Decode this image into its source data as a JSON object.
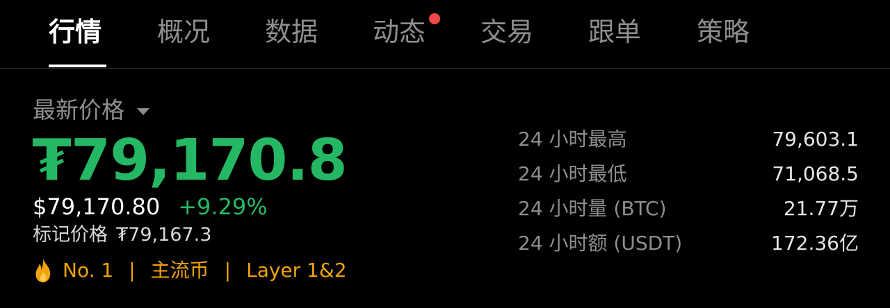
{
  "colors": {
    "background": "#000000",
    "positive": "#25b864",
    "accent_gold": "#f0a30a",
    "badge_red": "#f04848",
    "muted_text": "#8e8e8e"
  },
  "tabs": [
    {
      "label": "行情",
      "active": true
    },
    {
      "label": "概况",
      "active": false
    },
    {
      "label": "数据",
      "active": false
    },
    {
      "label": "动态",
      "active": false,
      "has_badge": true
    },
    {
      "label": "交易",
      "active": false
    },
    {
      "label": "跟单",
      "active": false
    },
    {
      "label": "策略",
      "active": false
    }
  ],
  "price": {
    "label": "最新价格",
    "main": "₮79,170.8",
    "usd": "$79,170.80",
    "change": "+9.29%",
    "mark_label": "标记价格",
    "mark_value": "₮79,167.3"
  },
  "tags": {
    "rank_icon": "flame-icon",
    "rank": "No. 1",
    "separator": "|",
    "category": "主流币",
    "layer": "Layer 1&2"
  },
  "stats": [
    {
      "label": "24 小时最高",
      "value": "79,603.1"
    },
    {
      "label": "24 小时最低",
      "value": "71,068.5"
    },
    {
      "label": "24 小时量 (BTC)",
      "value": "21.77万"
    },
    {
      "label": "24 小时额 (USDT)",
      "value": "172.36亿"
    }
  ]
}
